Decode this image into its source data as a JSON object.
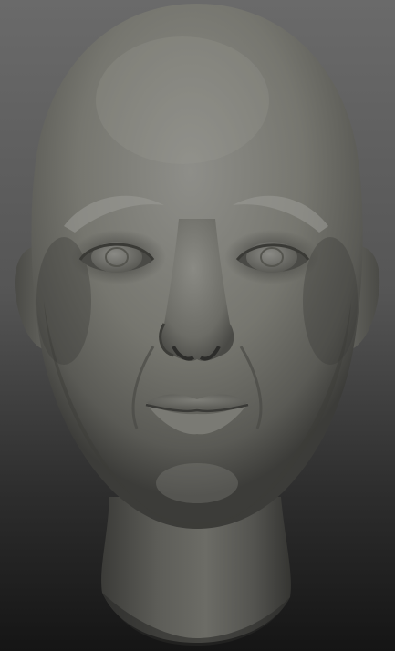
{
  "scene": {
    "subject": "sculpted-head-render",
    "colors": {
      "background_top": "#6a6a6a",
      "background_bottom": "#151515",
      "clay_light": "#8c8c87",
      "clay_mid": "#6f6f6a",
      "clay_dark": "#3a3a37",
      "clay_deep": "#242422"
    }
  }
}
